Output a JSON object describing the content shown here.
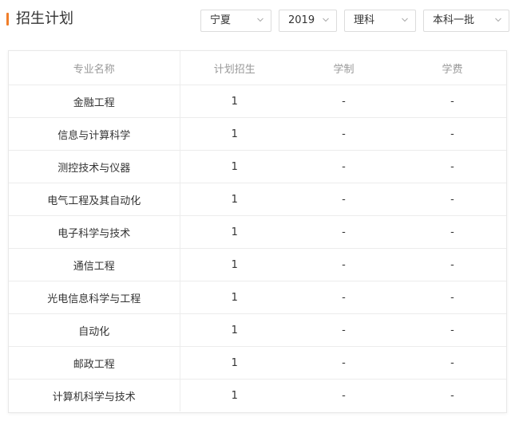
{
  "header": {
    "title": "招生计划"
  },
  "filters": {
    "province": "宁夏",
    "year": "2019",
    "subject": "理科",
    "batch": "本科一批"
  },
  "table": {
    "columns": [
      "专业名称",
      "计划招生",
      "学制",
      "学费"
    ],
    "rows": [
      {
        "name": "金融工程",
        "plan": "1",
        "duration": "-",
        "fee": "-"
      },
      {
        "name": "信息与计算科学",
        "plan": "1",
        "duration": "-",
        "fee": "-"
      },
      {
        "name": "测控技术与仪器",
        "plan": "1",
        "duration": "-",
        "fee": "-"
      },
      {
        "name": "电气工程及其自动化",
        "plan": "1",
        "duration": "-",
        "fee": "-"
      },
      {
        "name": "电子科学与技术",
        "plan": "1",
        "duration": "-",
        "fee": "-"
      },
      {
        "name": "通信工程",
        "plan": "1",
        "duration": "-",
        "fee": "-"
      },
      {
        "name": "光电信息科学与工程",
        "plan": "1",
        "duration": "-",
        "fee": "-"
      },
      {
        "name": "自动化",
        "plan": "1",
        "duration": "-",
        "fee": "-"
      },
      {
        "name": "邮政工程",
        "plan": "1",
        "duration": "-",
        "fee": "-"
      },
      {
        "name": "计算机科学与技术",
        "plan": "1",
        "duration": "-",
        "fee": "-"
      }
    ]
  },
  "colors": {
    "accent": "#f07e2a",
    "header_text": "#999999",
    "body_text": "#333333",
    "border": "#ececec"
  }
}
